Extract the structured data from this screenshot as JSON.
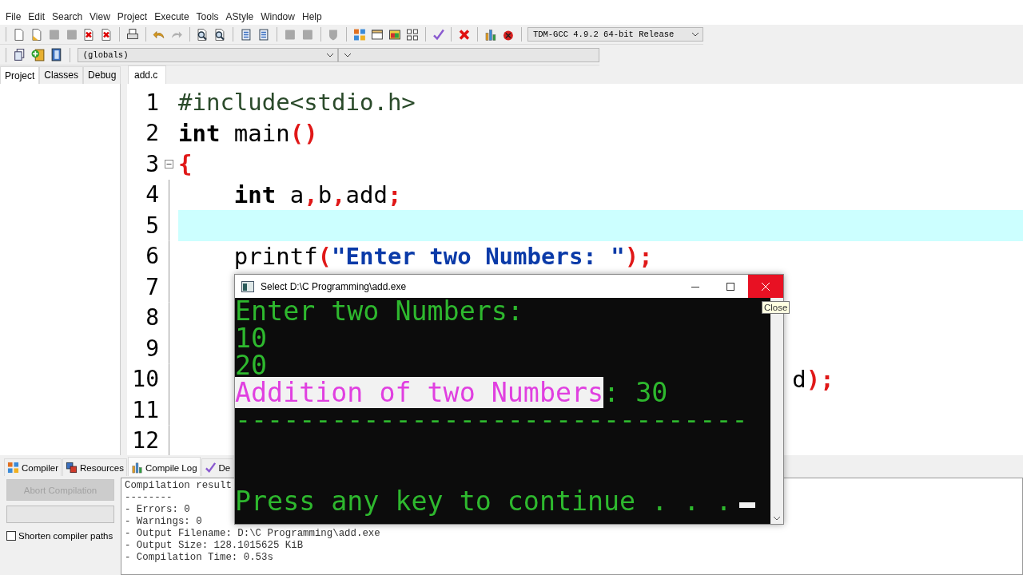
{
  "menu": [
    "File",
    "Edit",
    "Search",
    "View",
    "Project",
    "Execute",
    "Tools",
    "AStyle",
    "Window",
    "Help"
  ],
  "compiler_select": {
    "value": "TDM-GCC 4.9.2 64-bit Release"
  },
  "scope_select": {
    "value": "(globals)"
  },
  "side_tabs": [
    {
      "label": "Project",
      "selected": true
    },
    {
      "label": "Classes",
      "selected": false
    },
    {
      "label": "Debug",
      "selected": false
    }
  ],
  "editor_tabs": [
    {
      "label": "add.c",
      "selected": true
    }
  ],
  "code_lines": [
    {
      "number": "1",
      "current": false,
      "fold": false,
      "tokens": [
        {
          "kind": "pre",
          "text": "#include<stdio.h>"
        }
      ]
    },
    {
      "number": "2",
      "current": false,
      "fold": false,
      "tokens": [
        {
          "kind": "kw",
          "text": "int"
        },
        {
          "kind": "plain",
          "text": " main"
        },
        {
          "kind": "sym",
          "text": "()"
        }
      ]
    },
    {
      "number": "3",
      "current": false,
      "fold": true,
      "tokens": [
        {
          "kind": "sym",
          "text": "{"
        }
      ]
    },
    {
      "number": "4",
      "current": false,
      "fold": false,
      "tokens": [
        {
          "kind": "kw",
          "text": "    int"
        },
        {
          "kind": "plain",
          "text": " a"
        },
        {
          "kind": "sym",
          "text": ","
        },
        {
          "kind": "plain",
          "text": "b"
        },
        {
          "kind": "sym",
          "text": ","
        },
        {
          "kind": "plain",
          "text": "add"
        },
        {
          "kind": "sym",
          "text": ";"
        }
      ]
    },
    {
      "number": "5",
      "current": true,
      "fold": false
    },
    {
      "number": "6",
      "current": false,
      "fold": false,
      "tokens": [
        {
          "kind": "plain",
          "text": "    printf"
        },
        {
          "kind": "sym",
          "text": "("
        },
        {
          "kind": "str",
          "text": "\"Enter two Numbers: \""
        },
        {
          "kind": "sym",
          "text": ");"
        }
      ]
    },
    {
      "number": "7",
      "current": false,
      "fold": false
    },
    {
      "number": "8",
      "current": false,
      "fold": false
    },
    {
      "number": "9",
      "current": false,
      "fold": false
    },
    {
      "number": "10",
      "current": false,
      "fold": false,
      "tokens": [
        {
          "kind": "plain",
          "text": "                                            d"
        },
        {
          "kind": "sym",
          "text": ");"
        }
      ]
    },
    {
      "number": "11",
      "current": false,
      "fold": false
    },
    {
      "number": "12",
      "current": false,
      "fold": false
    }
  ],
  "console": {
    "title": "Select D:\\C Programming\\add.exe",
    "lines": [
      {
        "segments": [
          {
            "text": "Enter two Numbers:",
            "selected": false
          }
        ]
      },
      {
        "segments": [
          {
            "text": "10",
            "selected": false
          }
        ]
      },
      {
        "segments": [
          {
            "text": "20",
            "selected": false
          }
        ]
      },
      {
        "segments": [
          {
            "text": "Addition of two Numbers",
            "selected": true
          },
          {
            "text": ": 30",
            "selected": false
          }
        ]
      },
      {
        "segments": [
          {
            "text": "--------------------------------",
            "selected": false
          }
        ]
      },
      {
        "blank": true
      },
      {
        "blank": true
      },
      {
        "segments": [
          {
            "text": "Press any key to continue . . .",
            "selected": false
          }
        ],
        "cursor": true
      }
    ],
    "tooltip": "Close"
  },
  "bottom_tabs": [
    {
      "label": "Compiler",
      "selected": false
    },
    {
      "label": "Resources",
      "selected": false
    },
    {
      "label": "Compile Log",
      "selected": true
    },
    {
      "label": "De",
      "selected": false
    }
  ],
  "abort_button": {
    "label": "Abort Compilation",
    "disabled": true
  },
  "progress": {
    "level": 0
  },
  "shorten_checkbox": {
    "label": "Shorten compiler paths",
    "checked": false
  },
  "log_lines": [
    "Compilation result",
    "--------",
    "- Errors: 0",
    "- Warnings: 0",
    "- Output Filename: D:\\C Programming\\add.exe",
    "- Output Size: 128.1015625 KiB",
    "- Compilation Time: 0.53s"
  ]
}
